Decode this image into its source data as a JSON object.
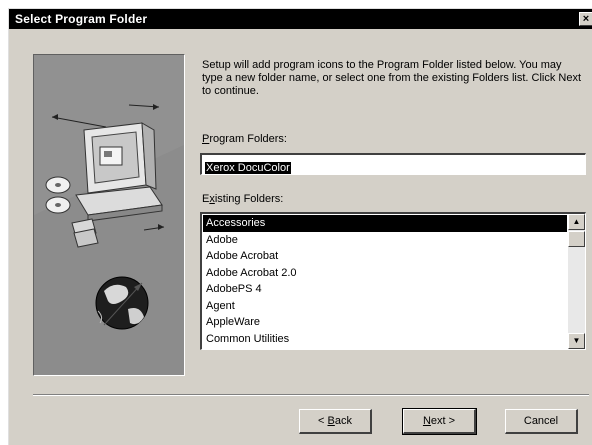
{
  "window": {
    "title": "Select Program Folder",
    "close_glyph": "×"
  },
  "description": "Setup will add program icons to the Program Folder listed below. You may type a new folder name, or select one from the existing Folders list.  Click Next to continue.",
  "program_folder": {
    "label_prefix": "",
    "label_underline": "P",
    "label_rest": "rogram Folders:",
    "value": "Xerox DocuColor"
  },
  "existing_folders": {
    "label_prefix": "E",
    "label_underline": "x",
    "label_rest": "isting Folders:",
    "items": [
      "Accessories",
      "Adobe",
      "Adobe Acrobat",
      "Adobe Acrobat 2.0",
      "AdobePS 4",
      "Agent",
      "AppleWare",
      "Common Utilities"
    ],
    "selected_index": 0
  },
  "buttons": {
    "back": {
      "prefix": "< ",
      "underline": "B",
      "rest": "ack"
    },
    "next": {
      "prefix": "",
      "underline": "N",
      "rest": "ext >"
    },
    "cancel": "Cancel"
  },
  "scrollbar": {
    "up_glyph": "▲",
    "down_glyph": "▼"
  },
  "icons": {
    "art": "setup-computer-cd-globe-illustration"
  }
}
